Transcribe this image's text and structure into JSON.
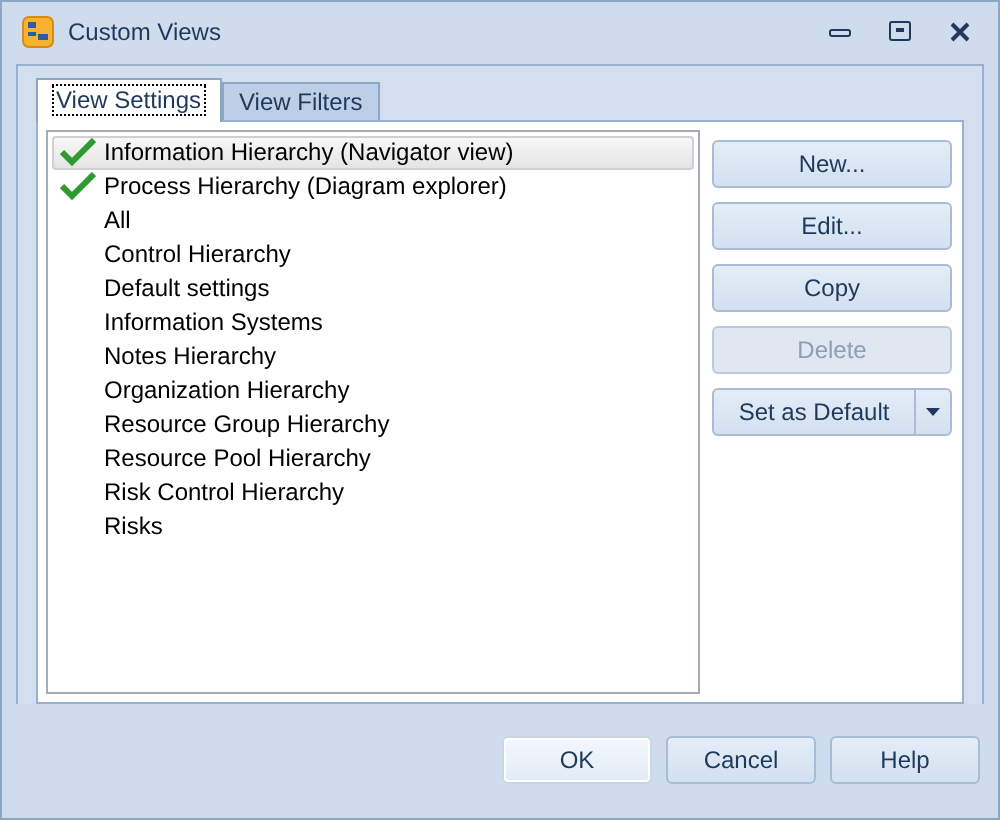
{
  "window": {
    "title": "Custom Views"
  },
  "tabs": [
    {
      "label": "View Settings",
      "selected": true
    },
    {
      "label": "View Filters",
      "selected": false
    }
  ],
  "views": [
    {
      "label": "Information Hierarchy (Navigator view)",
      "checked": true,
      "selected": true
    },
    {
      "label": "Process Hierarchy (Diagram explorer)",
      "checked": true,
      "selected": false
    },
    {
      "label": "All",
      "checked": false,
      "selected": false
    },
    {
      "label": "Control Hierarchy",
      "checked": false,
      "selected": false
    },
    {
      "label": "Default settings",
      "checked": false,
      "selected": false
    },
    {
      "label": "Information Systems",
      "checked": false,
      "selected": false
    },
    {
      "label": "Notes Hierarchy",
      "checked": false,
      "selected": false
    },
    {
      "label": "Organization Hierarchy",
      "checked": false,
      "selected": false
    },
    {
      "label": "Resource Group Hierarchy",
      "checked": false,
      "selected": false
    },
    {
      "label": "Resource Pool Hierarchy",
      "checked": false,
      "selected": false
    },
    {
      "label": "Risk Control Hierarchy",
      "checked": false,
      "selected": false
    },
    {
      "label": "Risks",
      "checked": false,
      "selected": false
    }
  ],
  "actions": [
    {
      "label": "New...",
      "kind": "plain",
      "disabled": false
    },
    {
      "label": "Edit...",
      "kind": "plain",
      "disabled": false
    },
    {
      "label": "Copy",
      "kind": "plain",
      "disabled": false
    },
    {
      "label": "Delete",
      "kind": "plain",
      "disabled": true
    },
    {
      "label": "Set as Default",
      "kind": "split",
      "disabled": false
    }
  ],
  "footer_buttons": [
    {
      "label": "OK",
      "selected": true
    },
    {
      "label": "Cancel",
      "selected": false
    },
    {
      "label": "Help",
      "selected": false
    }
  ]
}
